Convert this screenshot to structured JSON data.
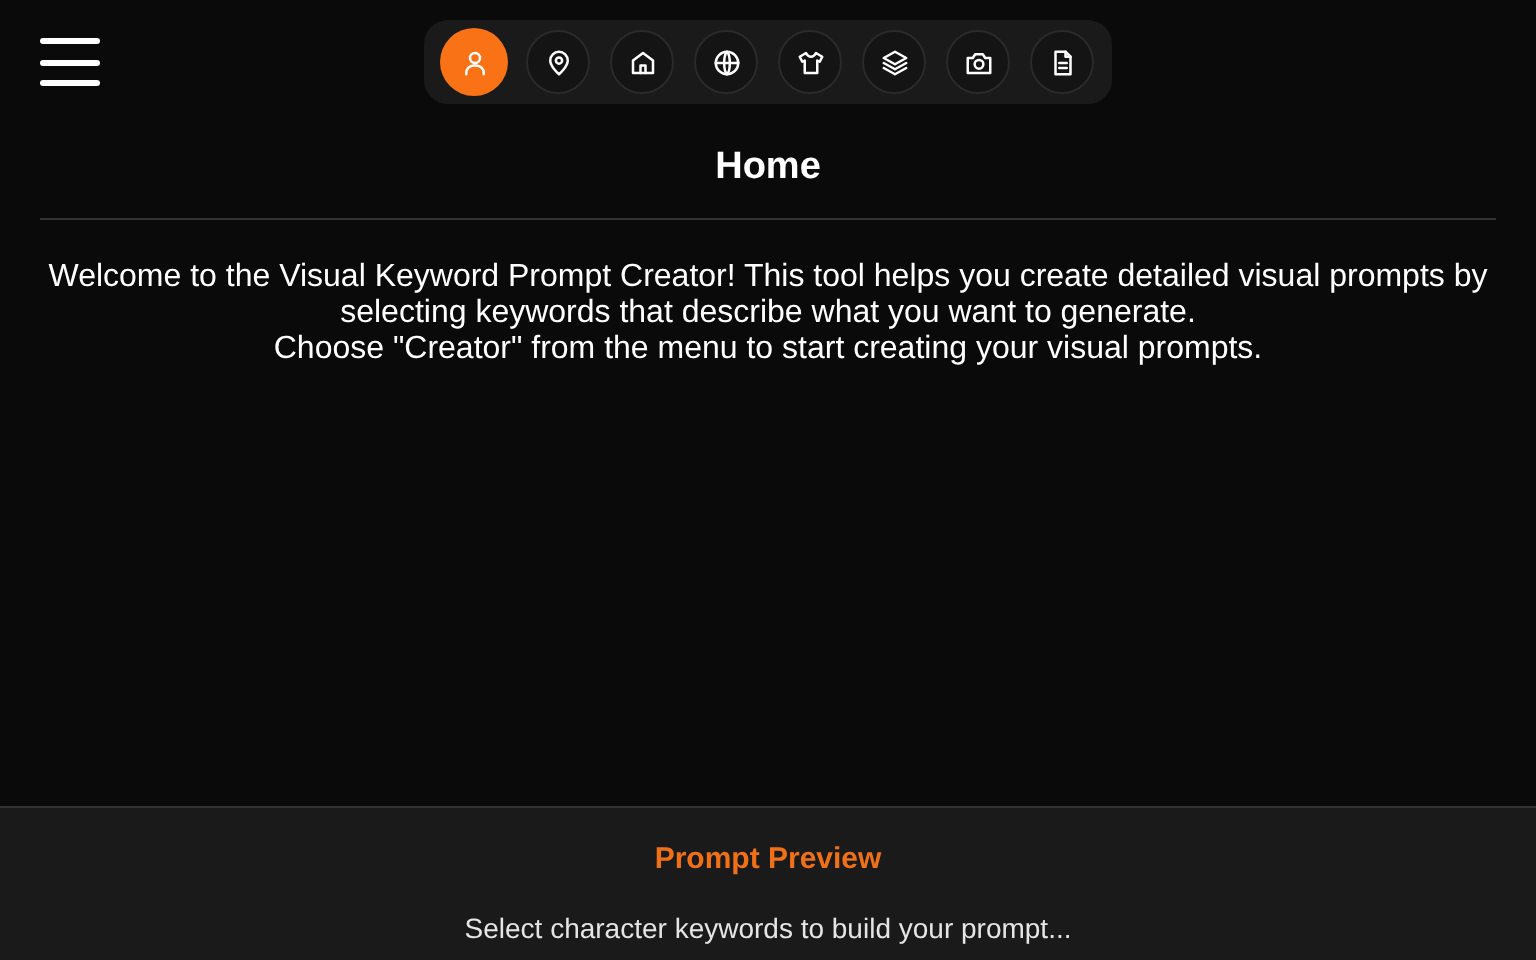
{
  "tabs": [
    {
      "kind": "person",
      "selected": true
    },
    {
      "kind": "pin",
      "selected": false
    },
    {
      "kind": "home",
      "selected": false
    },
    {
      "kind": "globe",
      "selected": false
    },
    {
      "kind": "shirt",
      "selected": false
    },
    {
      "kind": "layers",
      "selected": false
    },
    {
      "kind": "camera",
      "selected": false
    },
    {
      "kind": "document",
      "selected": false
    }
  ],
  "page": {
    "title": "Home",
    "intro": "Welcome to the Visual Keyword Prompt Creator! This tool helps you create detailed visual prompts by selecting keywords that describe what you want to generate.",
    "hint": "Choose \"Creator\" from the menu to start creating your visual prompts."
  },
  "preview": {
    "title": "Prompt Preview",
    "text": "Select character keywords to build your prompt..."
  }
}
